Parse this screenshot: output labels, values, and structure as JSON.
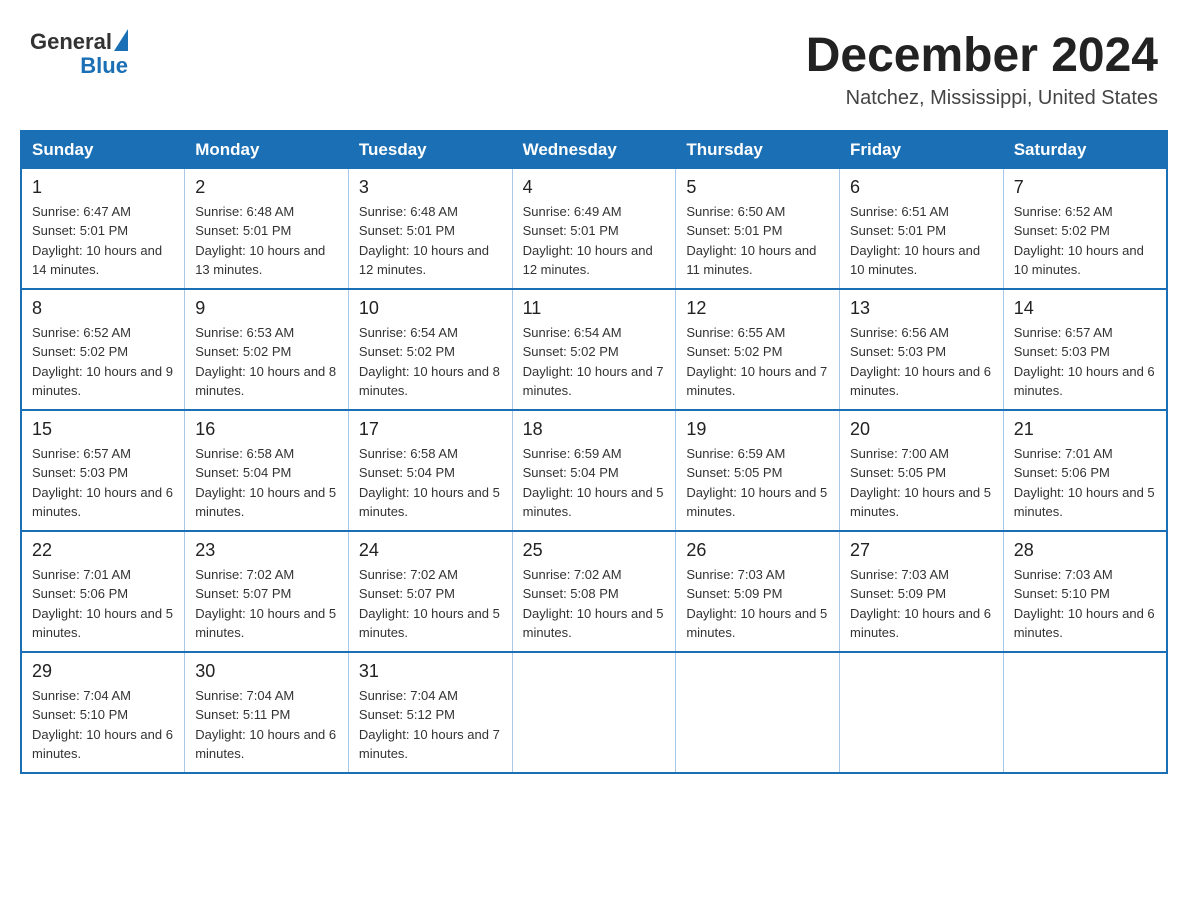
{
  "header": {
    "logo": {
      "general": "General",
      "blue": "Blue"
    },
    "title": "December 2024",
    "location": "Natchez, Mississippi, United States"
  },
  "calendar": {
    "days_of_week": [
      "Sunday",
      "Monday",
      "Tuesday",
      "Wednesday",
      "Thursday",
      "Friday",
      "Saturday"
    ],
    "weeks": [
      [
        {
          "day": "1",
          "sunrise": "6:47 AM",
          "sunset": "5:01 PM",
          "daylight": "10 hours and 14 minutes."
        },
        {
          "day": "2",
          "sunrise": "6:48 AM",
          "sunset": "5:01 PM",
          "daylight": "10 hours and 13 minutes."
        },
        {
          "day": "3",
          "sunrise": "6:48 AM",
          "sunset": "5:01 PM",
          "daylight": "10 hours and 12 minutes."
        },
        {
          "day": "4",
          "sunrise": "6:49 AM",
          "sunset": "5:01 PM",
          "daylight": "10 hours and 12 minutes."
        },
        {
          "day": "5",
          "sunrise": "6:50 AM",
          "sunset": "5:01 PM",
          "daylight": "10 hours and 11 minutes."
        },
        {
          "day": "6",
          "sunrise": "6:51 AM",
          "sunset": "5:01 PM",
          "daylight": "10 hours and 10 minutes."
        },
        {
          "day": "7",
          "sunrise": "6:52 AM",
          "sunset": "5:02 PM",
          "daylight": "10 hours and 10 minutes."
        }
      ],
      [
        {
          "day": "8",
          "sunrise": "6:52 AM",
          "sunset": "5:02 PM",
          "daylight": "10 hours and 9 minutes."
        },
        {
          "day": "9",
          "sunrise": "6:53 AM",
          "sunset": "5:02 PM",
          "daylight": "10 hours and 8 minutes."
        },
        {
          "day": "10",
          "sunrise": "6:54 AM",
          "sunset": "5:02 PM",
          "daylight": "10 hours and 8 minutes."
        },
        {
          "day": "11",
          "sunrise": "6:54 AM",
          "sunset": "5:02 PM",
          "daylight": "10 hours and 7 minutes."
        },
        {
          "day": "12",
          "sunrise": "6:55 AM",
          "sunset": "5:02 PM",
          "daylight": "10 hours and 7 minutes."
        },
        {
          "day": "13",
          "sunrise": "6:56 AM",
          "sunset": "5:03 PM",
          "daylight": "10 hours and 6 minutes."
        },
        {
          "day": "14",
          "sunrise": "6:57 AM",
          "sunset": "5:03 PM",
          "daylight": "10 hours and 6 minutes."
        }
      ],
      [
        {
          "day": "15",
          "sunrise": "6:57 AM",
          "sunset": "5:03 PM",
          "daylight": "10 hours and 6 minutes."
        },
        {
          "day": "16",
          "sunrise": "6:58 AM",
          "sunset": "5:04 PM",
          "daylight": "10 hours and 5 minutes."
        },
        {
          "day": "17",
          "sunrise": "6:58 AM",
          "sunset": "5:04 PM",
          "daylight": "10 hours and 5 minutes."
        },
        {
          "day": "18",
          "sunrise": "6:59 AM",
          "sunset": "5:04 PM",
          "daylight": "10 hours and 5 minutes."
        },
        {
          "day": "19",
          "sunrise": "6:59 AM",
          "sunset": "5:05 PM",
          "daylight": "10 hours and 5 minutes."
        },
        {
          "day": "20",
          "sunrise": "7:00 AM",
          "sunset": "5:05 PM",
          "daylight": "10 hours and 5 minutes."
        },
        {
          "day": "21",
          "sunrise": "7:01 AM",
          "sunset": "5:06 PM",
          "daylight": "10 hours and 5 minutes."
        }
      ],
      [
        {
          "day": "22",
          "sunrise": "7:01 AM",
          "sunset": "5:06 PM",
          "daylight": "10 hours and 5 minutes."
        },
        {
          "day": "23",
          "sunrise": "7:02 AM",
          "sunset": "5:07 PM",
          "daylight": "10 hours and 5 minutes."
        },
        {
          "day": "24",
          "sunrise": "7:02 AM",
          "sunset": "5:07 PM",
          "daylight": "10 hours and 5 minutes."
        },
        {
          "day": "25",
          "sunrise": "7:02 AM",
          "sunset": "5:08 PM",
          "daylight": "10 hours and 5 minutes."
        },
        {
          "day": "26",
          "sunrise": "7:03 AM",
          "sunset": "5:09 PM",
          "daylight": "10 hours and 5 minutes."
        },
        {
          "day": "27",
          "sunrise": "7:03 AM",
          "sunset": "5:09 PM",
          "daylight": "10 hours and 6 minutes."
        },
        {
          "day": "28",
          "sunrise": "7:03 AM",
          "sunset": "5:10 PM",
          "daylight": "10 hours and 6 minutes."
        }
      ],
      [
        {
          "day": "29",
          "sunrise": "7:04 AM",
          "sunset": "5:10 PM",
          "daylight": "10 hours and 6 minutes."
        },
        {
          "day": "30",
          "sunrise": "7:04 AM",
          "sunset": "5:11 PM",
          "daylight": "10 hours and 6 minutes."
        },
        {
          "day": "31",
          "sunrise": "7:04 AM",
          "sunset": "5:12 PM",
          "daylight": "10 hours and 7 minutes."
        },
        null,
        null,
        null,
        null
      ]
    ]
  }
}
